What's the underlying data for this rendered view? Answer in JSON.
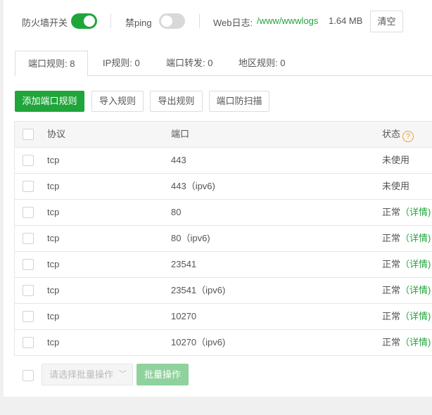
{
  "topbar": {
    "firewall_label": "防火墙开关",
    "firewall_on": true,
    "ping_label": "禁ping",
    "ping_on": false,
    "weblog_label": "Web日志:",
    "weblog_path": "/www/wwwlogs",
    "weblog_size": "1.64 MB",
    "clear_button": "清空"
  },
  "tabs": [
    {
      "label": "端口规则: 8",
      "active": true
    },
    {
      "label": "IP规则: 0",
      "active": false
    },
    {
      "label": "端口转发: 0",
      "active": false
    },
    {
      "label": "地区规则: 0",
      "active": false
    }
  ],
  "toolbar": {
    "add_port_rule": "添加端口规则",
    "import_rules": "导入规则",
    "export_rules": "导出规则",
    "port_scan_protect": "端口防扫描"
  },
  "table": {
    "headers": {
      "protocol": "协议",
      "port": "端口",
      "status": "状态"
    },
    "help_icon": "?",
    "rows": [
      {
        "protocol": "tcp",
        "port": "443",
        "status": "未使用",
        "detail": ""
      },
      {
        "protocol": "tcp",
        "port": "443（ipv6)",
        "status": "未使用",
        "detail": ""
      },
      {
        "protocol": "tcp",
        "port": "80",
        "status": "正常",
        "detail": "（详情)"
      },
      {
        "protocol": "tcp",
        "port": "80（ipv6)",
        "status": "正常",
        "detail": "（详情)"
      },
      {
        "protocol": "tcp",
        "port": "23541",
        "status": "正常",
        "detail": "（详情)"
      },
      {
        "protocol": "tcp",
        "port": "23541（ipv6)",
        "status": "正常",
        "detail": "（详情)"
      },
      {
        "protocol": "tcp",
        "port": "10270",
        "status": "正常",
        "detail": "（详情)"
      },
      {
        "protocol": "tcp",
        "port": "10270（ipv6)",
        "status": "正常",
        "detail": "（详情)"
      }
    ]
  },
  "footer": {
    "batch_select_placeholder": "请选择批量操作",
    "batch_button": "批量操作"
  },
  "colors": {
    "accent": "#20a53a",
    "help": "#f0a020"
  }
}
